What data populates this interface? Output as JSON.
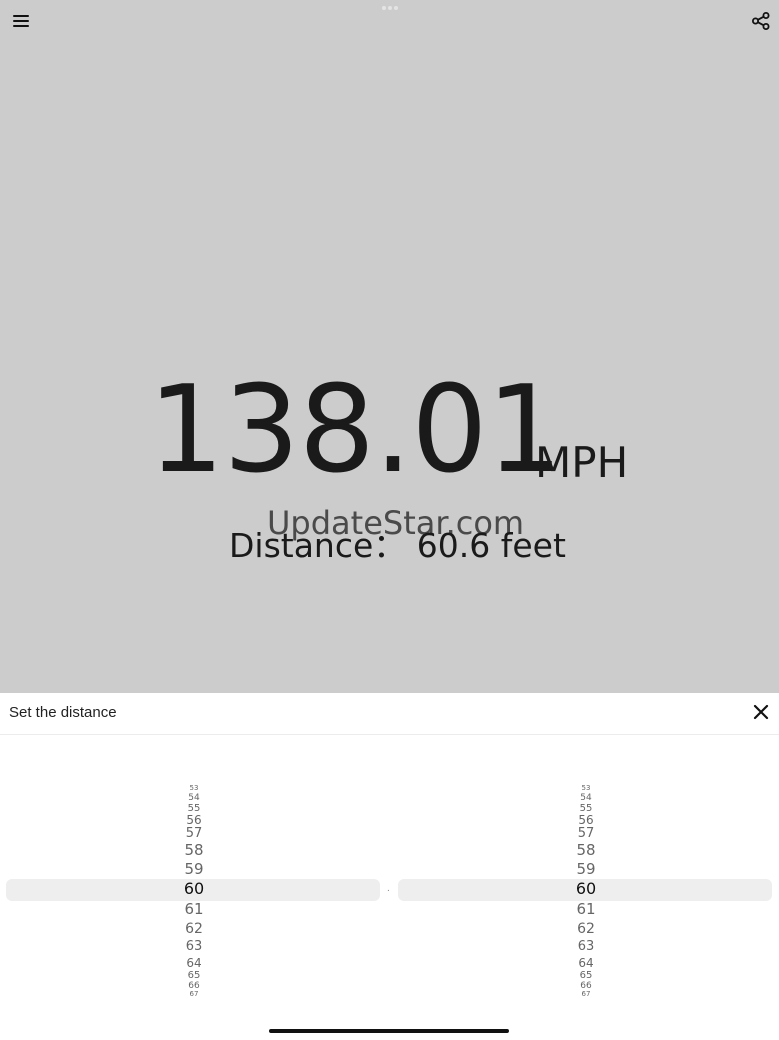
{
  "header": {
    "menu_icon": "hamburger-menu-icon",
    "share_icon": "share-icon",
    "multitask_icon": "three-dots-icon"
  },
  "speed": {
    "value": "138.01",
    "unit": "MPH"
  },
  "watermark": "UpdateStar.com",
  "distance": {
    "label": "Distance：",
    "value": "60.6 feet"
  },
  "panel": {
    "title": "Set the distance",
    "close_icon": "close-icon",
    "separator": ".",
    "left_wheel": {
      "items": [
        "53",
        "54",
        "55",
        "56",
        "57",
        "58",
        "59",
        "60",
        "61",
        "62",
        "63",
        "64",
        "65",
        "66",
        "67"
      ],
      "selected": "60"
    },
    "right_wheel": {
      "items": [
        "53",
        "54",
        "55",
        "56",
        "57",
        "58",
        "59",
        "60",
        "61",
        "62",
        "63",
        "64",
        "65",
        "66",
        "67"
      ],
      "selected": "60"
    }
  },
  "colors": {
    "background_top": "#cccccc",
    "panel": "#ffffff",
    "text": "#1a1a1a",
    "highlight": "#eeeeee"
  }
}
